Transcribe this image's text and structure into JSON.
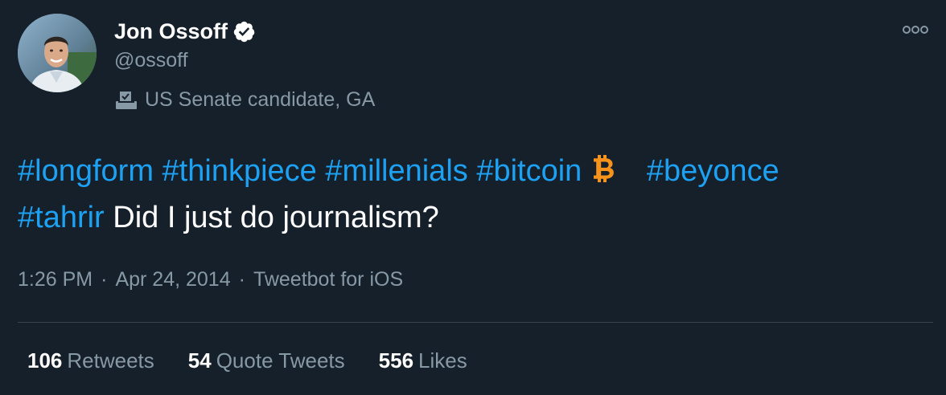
{
  "author": {
    "name": "Jon Ossoff",
    "handle": "@ossoff",
    "verified": true,
    "avatar_icon": "profile-photo",
    "label": "US Senate candidate, GA",
    "label_icon": "ballot-box-icon"
  },
  "menu": {
    "icon": "more-options-icon"
  },
  "tweet": {
    "hashtags": [
      "#longform",
      "#thinkpiece",
      "#millenials",
      "#bitcoin",
      "#beyonce",
      "#tahrir"
    ],
    "emoji_icon": "bitcoin-icon",
    "text": "Did I just do journalism?"
  },
  "meta": {
    "time": "1:26 PM",
    "separator": "·",
    "date": "Apr 24, 2014",
    "source": "Tweetbot for iOS"
  },
  "stats": {
    "retweets": {
      "count": "106",
      "label": "Retweets"
    },
    "quotes": {
      "count": "54",
      "label": "Quote Tweets"
    },
    "likes": {
      "count": "556",
      "label": "Likes"
    }
  },
  "colors": {
    "background": "#15202b",
    "link": "#1da1f2",
    "secondary_text": "#8899a6",
    "divider": "#38444d",
    "bitcoin": "#f7931a"
  }
}
